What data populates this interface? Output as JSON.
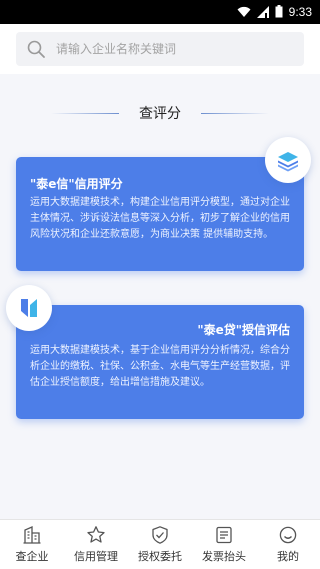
{
  "status_bar": {
    "time": "9:33",
    "icons": [
      "wifi-icon",
      "signal-icon",
      "battery-icon"
    ]
  },
  "search": {
    "placeholder": "请输入企业名称关键词"
  },
  "section": {
    "title": "查评分"
  },
  "cards": [
    {
      "title": "\"泰e信\"信用评分",
      "body": "运用大数据建模技术，构建企业信用评分模型，通过对企业主体情况、涉诉设法信息等深入分析，初步了解企业的信用风险状况和企业还款意愿，为商业决策 提供辅助支持。",
      "icon": "layers-icon"
    },
    {
      "title": "\"泰e贷\"授信评估",
      "body": "运用大数据建模技术，基于企业信用评分分析情况，综合分析企业的缴税、社保、公积金、水电气等生产经营数据，评估企业授信额度，给出增信措施及建议。",
      "icon": "transfer-icon"
    }
  ],
  "tabbar": [
    {
      "label": "查企业",
      "icon": "building-icon"
    },
    {
      "label": "信用管理",
      "icon": "star-icon"
    },
    {
      "label": "授权委托",
      "icon": "shield-check-icon"
    },
    {
      "label": "发票抬头",
      "icon": "invoice-icon"
    },
    {
      "label": "我的",
      "icon": "smile-icon"
    }
  ],
  "colors": {
    "card": "#4d7ee8",
    "accent": "#6d8fcf",
    "background": "#f5f6fa"
  }
}
